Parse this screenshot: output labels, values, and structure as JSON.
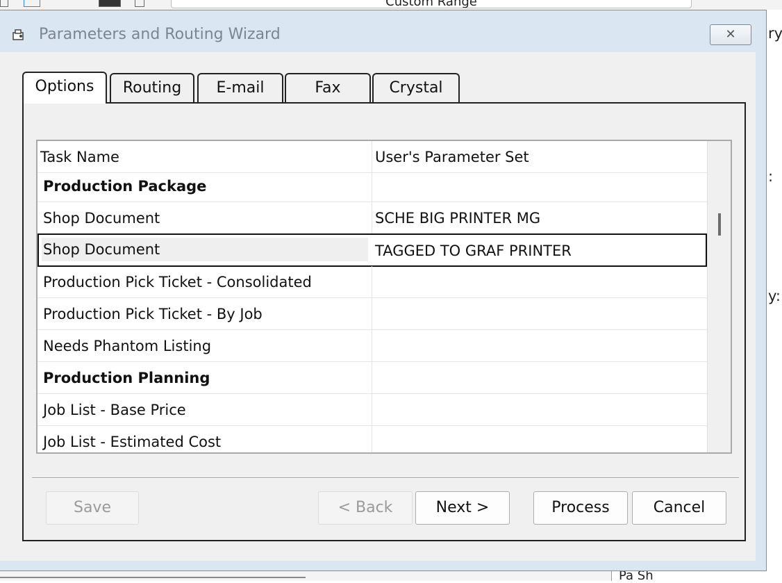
{
  "background": {
    "top_field_text": "Custom Range",
    "right_fragments": [
      "ry",
      ":",
      "y:"
    ],
    "bottom_right_text": "Pa    Sh"
  },
  "dialog": {
    "title": "Parameters and Routing Wizard",
    "close_glyph": "✕"
  },
  "tabs": [
    {
      "label": "Options",
      "active": true
    },
    {
      "label": "Routing",
      "active": false
    },
    {
      "label": "E-mail",
      "active": false
    },
    {
      "label": "Fax",
      "active": false
    },
    {
      "label": "Crystal",
      "active": false
    }
  ],
  "grid": {
    "columns": [
      "Task Name",
      "User's Parameter Set"
    ],
    "rows": [
      {
        "task": "Production Package",
        "param": "",
        "group": true
      },
      {
        "task": "Shop Document",
        "param": "SCHE BIG PRINTER MG",
        "group": false
      },
      {
        "task": "Shop Document",
        "param": "TAGGED TO GRAF PRINTER",
        "group": false,
        "selected": true
      },
      {
        "task": "Production Pick Ticket - Consolidated",
        "param": "",
        "group": false
      },
      {
        "task": "Production Pick Ticket - By Job",
        "param": "",
        "group": false
      },
      {
        "task": "Needs Phantom Listing",
        "param": "",
        "group": false
      },
      {
        "task": "Production Planning",
        "param": "",
        "group": true
      },
      {
        "task": "Job List - Base Price",
        "param": "",
        "group": false
      },
      {
        "task": "Job List - Estimated Cost",
        "param": "",
        "group": false
      }
    ]
  },
  "buttons": {
    "save": "Save",
    "back": "< Back",
    "next": "Next >",
    "process": "Process",
    "cancel": "Cancel"
  },
  "colors": {
    "dialog_frame": "#dbe6f3",
    "client": "#f0f0f0",
    "title_text": "#7c8591"
  }
}
